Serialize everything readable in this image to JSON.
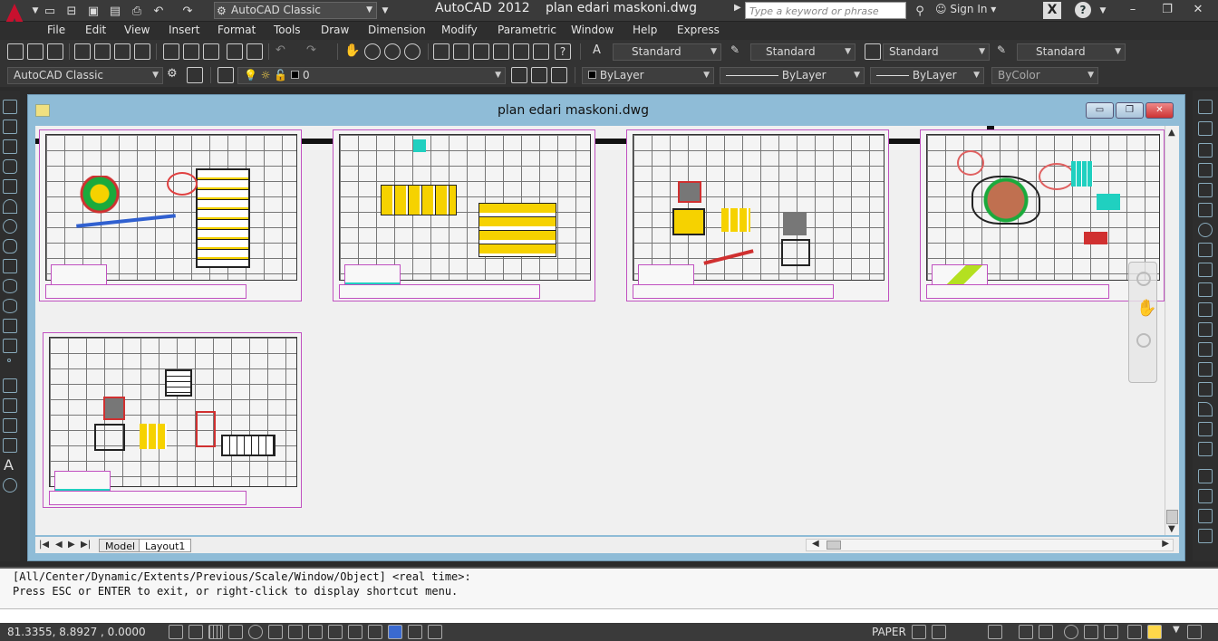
{
  "titlebar": {
    "app_name": "AutoCAD 2012",
    "file_name": "plan edari maskoni.dwg",
    "workspace": "AutoCAD Classic",
    "search_placeholder": "Type a keyword or phrase",
    "sign_in": "Sign In"
  },
  "menu": [
    "File",
    "Edit",
    "View",
    "Insert",
    "Format",
    "Tools",
    "Draw",
    "Dimension",
    "Modify",
    "Parametric",
    "Window",
    "Help",
    "Express"
  ],
  "styles_toolbar": {
    "text_style": "Standard",
    "dim_style": "Standard",
    "table_style": "Standard",
    "multileader_style": "Standard"
  },
  "layers_toolbar": {
    "workspace": "AutoCAD Classic",
    "layer": "0",
    "color": "ByLayer",
    "linetype": "ByLayer",
    "lineweight": "ByLayer",
    "plotstyle": "ByColor"
  },
  "drawing_window": {
    "title": "plan edari maskoni.dwg",
    "minimize": "▭",
    "restore": "❐",
    "close": "✕"
  },
  "layout_tabs": [
    "Model",
    "Layout1"
  ],
  "command": {
    "line1": "[All/Center/Dynamic/Extents/Previous/Scale/Window/Object] <real time>:",
    "line2": "Press ESC or ENTER to exit, or right-click to display shortcut menu."
  },
  "status": {
    "coords": "81.3355, 8.8927 , 0.0000",
    "paper": "PAPER"
  },
  "colors": {
    "sheet_border": "#c050c0",
    "window_frame": "#8fbcd7"
  }
}
